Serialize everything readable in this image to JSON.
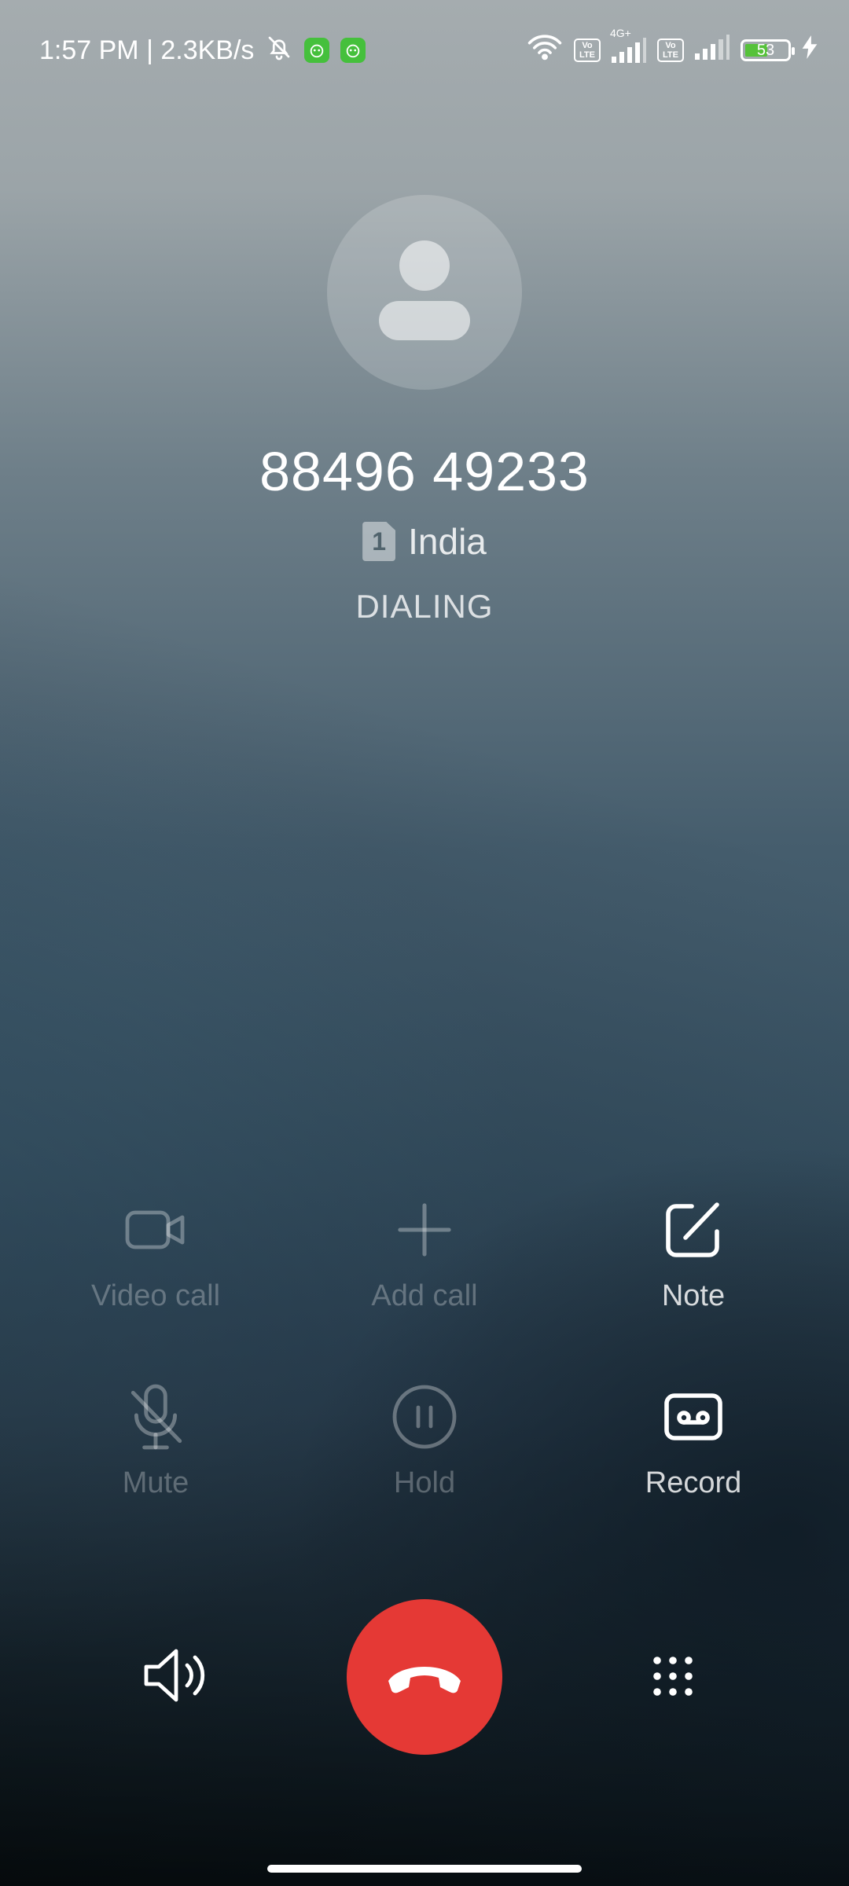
{
  "status_bar": {
    "time_and_speed": "1:57 PM | 2.3KB/s",
    "network_type": "4G+",
    "volte_label": "Vo LTE",
    "battery_level": "53"
  },
  "contact": {
    "phone_number": "88496 49233",
    "sim_number": "1",
    "location": "India",
    "call_status": "DIALING"
  },
  "actions": {
    "video_call": "Video call",
    "add_call": "Add call",
    "note": "Note",
    "mute": "Mute",
    "hold": "Hold",
    "record": "Record"
  },
  "colors": {
    "end_call": "#e53935",
    "app_badge": "#45c03c",
    "battery_fill": "#56c23a"
  }
}
